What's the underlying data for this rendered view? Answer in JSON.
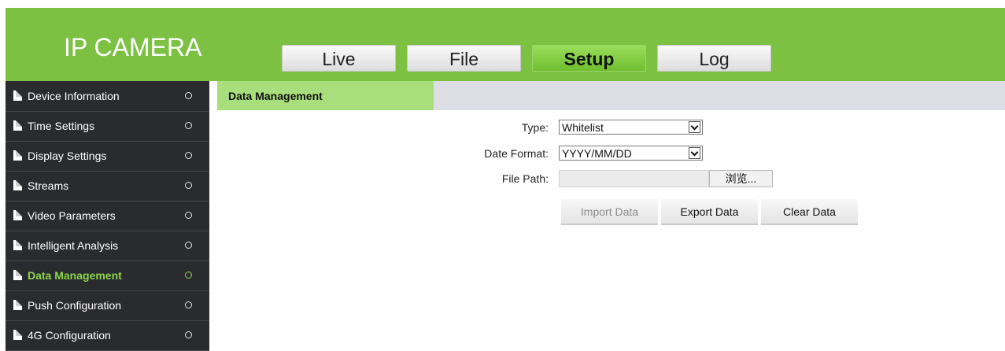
{
  "header": {
    "logo": "IP CAMERA",
    "nav": [
      {
        "label": "Live"
      },
      {
        "label": "File"
      },
      {
        "label": "Setup",
        "active": true
      },
      {
        "label": "Log"
      }
    ]
  },
  "sidebar": {
    "items": [
      {
        "label": "Device Information"
      },
      {
        "label": "Time Settings"
      },
      {
        "label": "Display Settings"
      },
      {
        "label": "Streams"
      },
      {
        "label": "Video Parameters"
      },
      {
        "label": "Intelligent Analysis"
      },
      {
        "label": "Data Management",
        "active": true
      },
      {
        "label": "Push Configuration"
      },
      {
        "label": "4G Configuration"
      }
    ]
  },
  "main": {
    "title": "Data Management",
    "form": {
      "type_label": "Type:",
      "type_value": "Whitelist",
      "date_format_label": "Date Format:",
      "date_format_value": "YYYY/MM/DD",
      "file_path_label": "File Path:",
      "file_path_value": "",
      "browse_label": "浏览..."
    },
    "buttons": {
      "import": "Import Data",
      "export": "Export Data",
      "clear": "Clear Data"
    }
  },
  "colors": {
    "brand_green": "#7cc142",
    "active_green": "#8bd64a",
    "sidebar_bg": "#2a2b2f"
  }
}
